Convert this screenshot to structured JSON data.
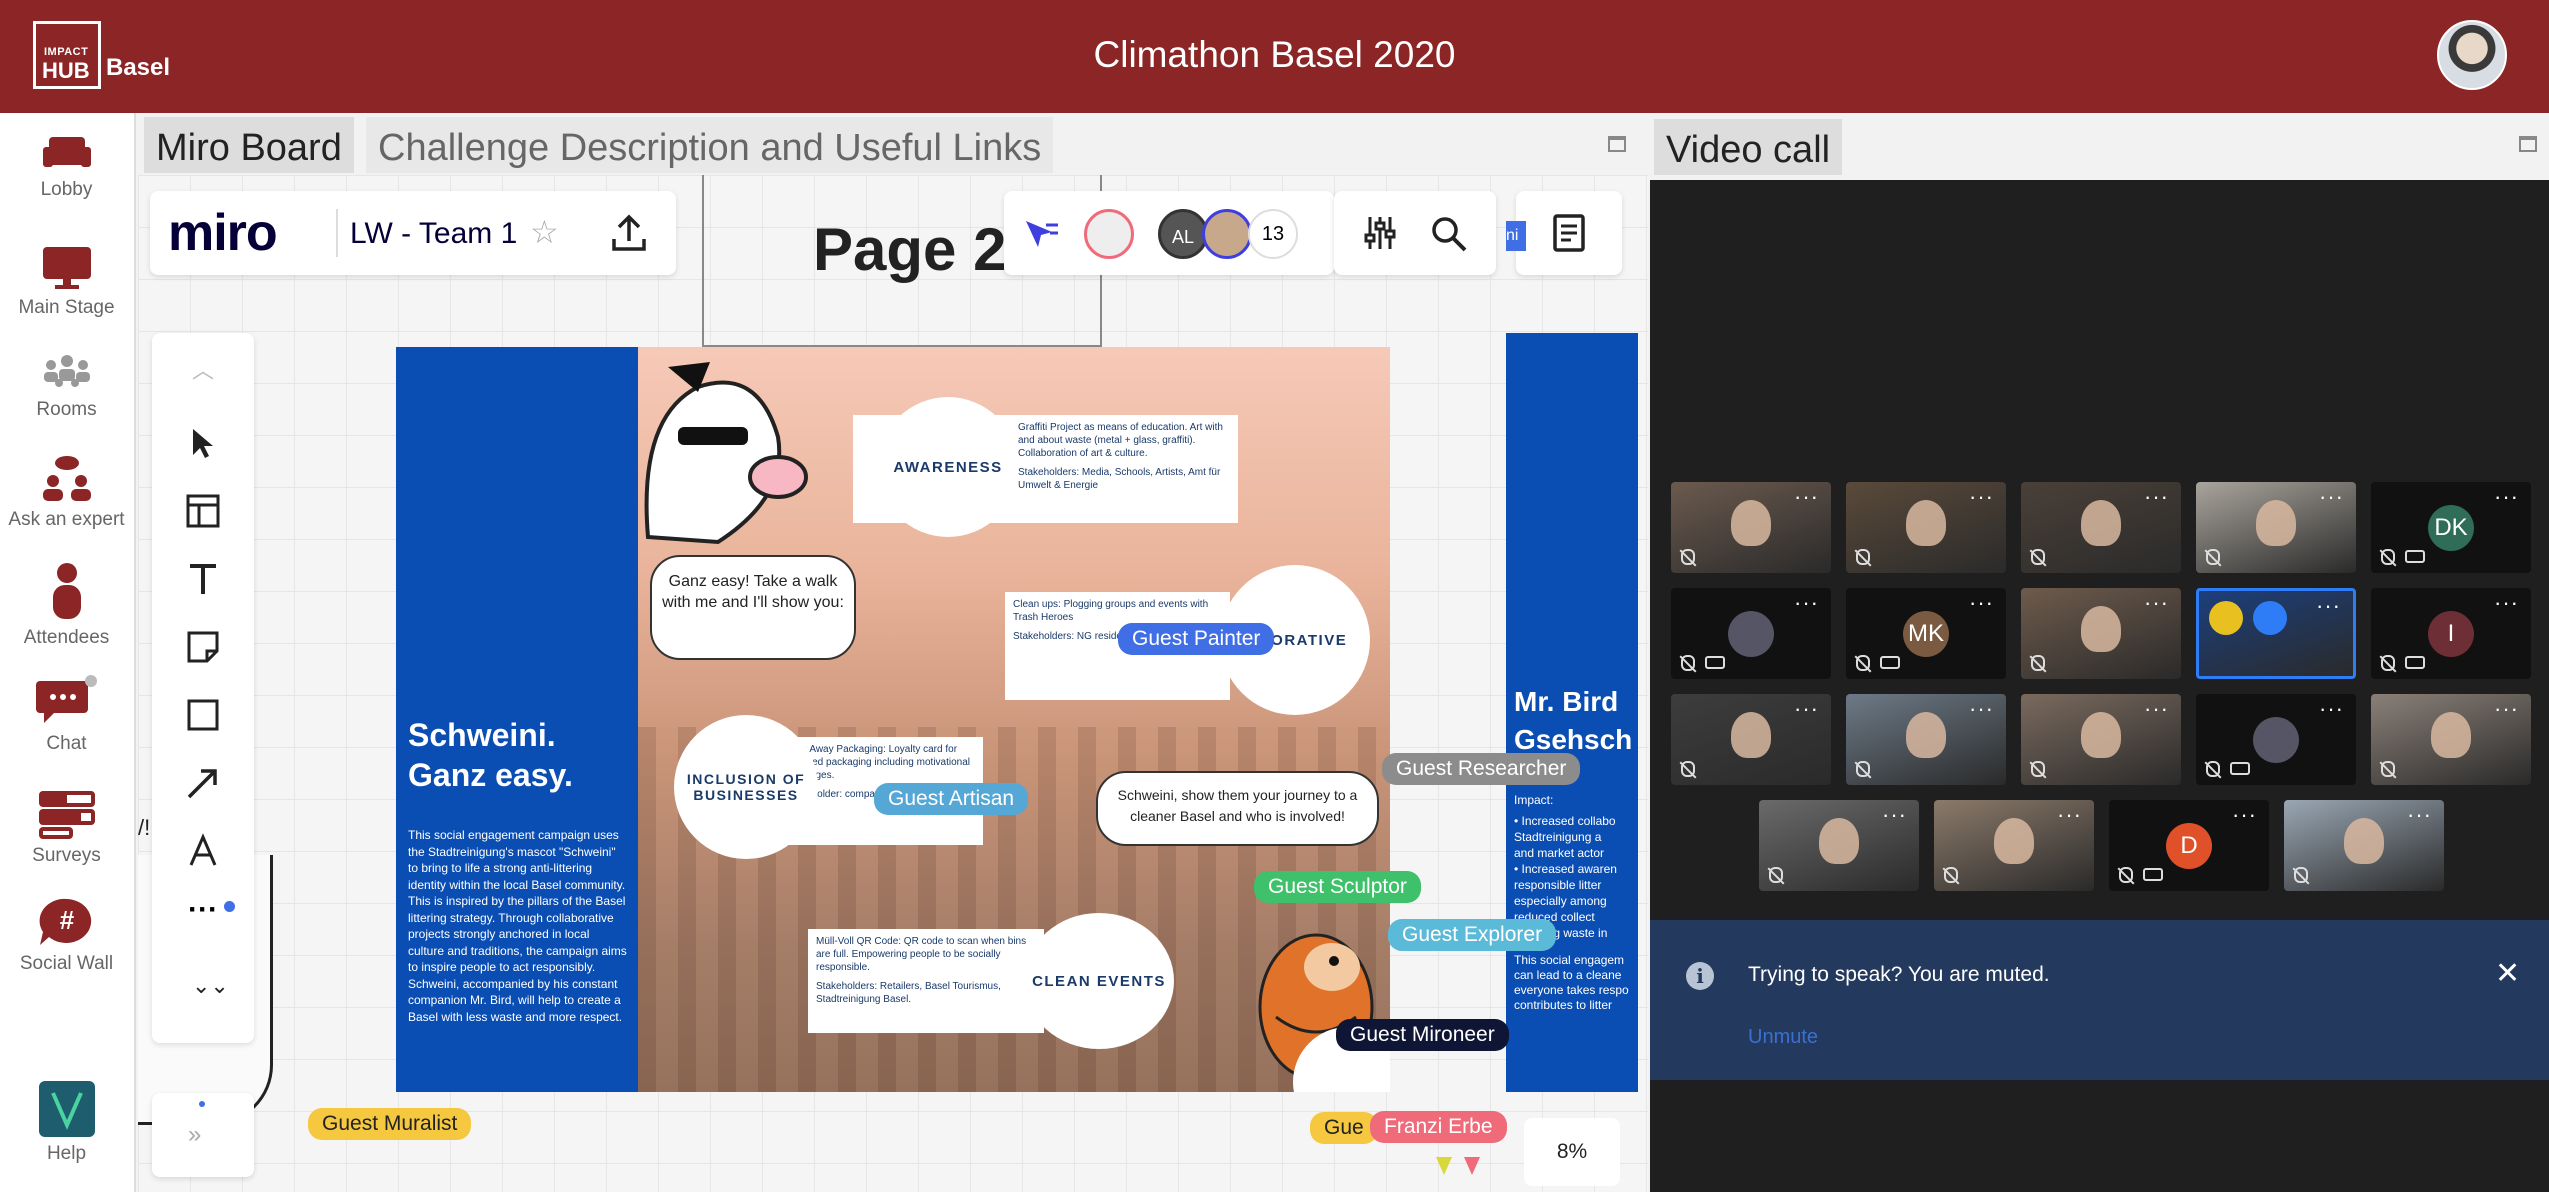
{
  "header": {
    "logo_small": "IMPACT",
    "logo_big": "HUB",
    "logo_city": "Basel",
    "title": "Climathon Basel 2020"
  },
  "sidebar": {
    "items": [
      {
        "label": "Lobby",
        "icon": "sofa-icon"
      },
      {
        "label": "Main Stage",
        "icon": "monitor-icon"
      },
      {
        "label": "Rooms",
        "icon": "group-icon"
      },
      {
        "label": "Ask an expert",
        "icon": "experts-icon"
      },
      {
        "label": "Attendees",
        "icon": "person-icon"
      },
      {
        "label": "Chat",
        "icon": "chat-icon"
      },
      {
        "label": "Surveys",
        "icon": "survey-icon"
      },
      {
        "label": "Social Wall",
        "icon": "hashtag-icon"
      },
      {
        "label": "Help",
        "icon": "help-v-icon"
      }
    ],
    "accent": "#8b2526",
    "help_color": "#1d5d6d"
  },
  "miro_panel": {
    "tabs": [
      "Miro Board",
      "Challenge Description and Useful Links"
    ],
    "logo": "miro",
    "board_name": "LW - Team 1",
    "participants": [
      "AL"
    ],
    "participant_count": "13",
    "page_label": "Page 2",
    "zoom": "8%",
    "edge_text": "ni",
    "edge_letter": "/!"
  },
  "poster": {
    "left_title_1": "Schweini.",
    "left_title_2": "Ganz easy.",
    "left_body": "This social engagement campaign uses the Stadtreinigung's mascot \"Schweini\" to bring to life a strong anti-littering identity within the local Basel community. This is inspired by the pillars of the Basel littering strategy. Through collaborative projects strongly anchored in local culture and traditions, the campaign aims to inspire people to act responsibly. Schweini, accompanied by his constant companion Mr. Bird, will help to create a Basel with less waste and more respect.",
    "bubble_1": "Ganz easy! Take a walk with me and I'll show you:",
    "bubble_2": "Schweini, show them your journey to a cleaner Basel and who is involved!",
    "awareness": "AWARENESS",
    "awareness_card_1": "Graffiti Project as means of education. Art with and about waste (metal + glass, graffiti). Collaboration of art & culture.",
    "awareness_card_2": "Stakeholders: Media, Schools, Artists, Amt für Umwelt & Energie",
    "social_circle": "AL ORATIVE",
    "cleanup_card_1": "Clean ups: Plogging groups and events with Trash Heroes",
    "cleanup_card_2": "Stakeholders: NG residents, Trash Heroes",
    "inclusion": "INCLUSION OF BUSINESSES",
    "inclusion_card_1": "Take Away Packaging: Loyalty card for returned packaging including motivational messages.",
    "inclusion_card_2": "Stakeholder: companies, p",
    "clean_events": "CLEAN EVENTS",
    "events_card_1": "Müll-Voll QR Code: QR code to scan when bins are full. Empowering people to be socially responsible.",
    "events_card_2": "Stakeholders: Retailers, Basel Tourismus, Stadtreinigung Basel.",
    "right_title_1": "Mr. Bird",
    "right_title_2": "Gsehsch",
    "right_impact": "Impact:",
    "right_bullets": [
      "• Increased collabo",
      "Stadtreinigung a",
      "and market actor",
      "• Increased awaren",
      "responsible litter",
      "especially among",
      "reduced collect",
      "reducing waste in"
    ],
    "right_footer": [
      "This social engagem",
      "can lead to a cleane",
      "everyone takes respo",
      "contributes to litter"
    ]
  },
  "cursors": [
    {
      "name": "Guest Painter",
      "color": "#3f6ee5"
    },
    {
      "name": "Guest Artisan",
      "color": "#55a7d6"
    },
    {
      "name": "Guest Researcher",
      "color": "#8c8c8c"
    },
    {
      "name": "Guest Sculptor",
      "color": "#3fc06a"
    },
    {
      "name": "Guest Explorer",
      "color": "#5bbad8"
    },
    {
      "name": "Guest Mironeer",
      "color": "#0f1535"
    },
    {
      "name": "Guest Muralist",
      "color": "#f5c840"
    },
    {
      "name": "Gue",
      "color": "#f5c840"
    },
    {
      "name": "Franzi Erbe",
      "color": "#ef6b7a"
    }
  ],
  "video_panel": {
    "tab": "Video call",
    "participants": [
      {
        "initials": "",
        "muted": true
      },
      {
        "initials": "",
        "muted": true
      },
      {
        "initials": "",
        "muted": true
      },
      {
        "initials": "",
        "muted": true
      },
      {
        "initials": "DK",
        "muted": true,
        "cam_off": true
      },
      {
        "initials": "",
        "muted": true,
        "cam_off": true
      },
      {
        "initials": "MK",
        "muted": true,
        "cam_off": true
      },
      {
        "initials": "",
        "muted": true
      },
      {
        "initials": "",
        "muted": false,
        "active": true
      },
      {
        "initials": "I",
        "muted": true,
        "cam_off": true
      },
      {
        "initials": "",
        "muted": true
      },
      {
        "initials": "",
        "muted": true
      },
      {
        "initials": "",
        "muted": true
      },
      {
        "initials": "",
        "muted": true,
        "cam_off": true
      },
      {
        "initials": "",
        "muted": true
      },
      {
        "initials": "",
        "muted": true
      },
      {
        "initials": "",
        "muted": true
      },
      {
        "initials": "D",
        "muted": true,
        "cam_off": true
      },
      {
        "initials": "",
        "muted": true
      }
    ],
    "notice_text": "Trying to speak? You are muted.",
    "notice_action": "Unmute"
  }
}
